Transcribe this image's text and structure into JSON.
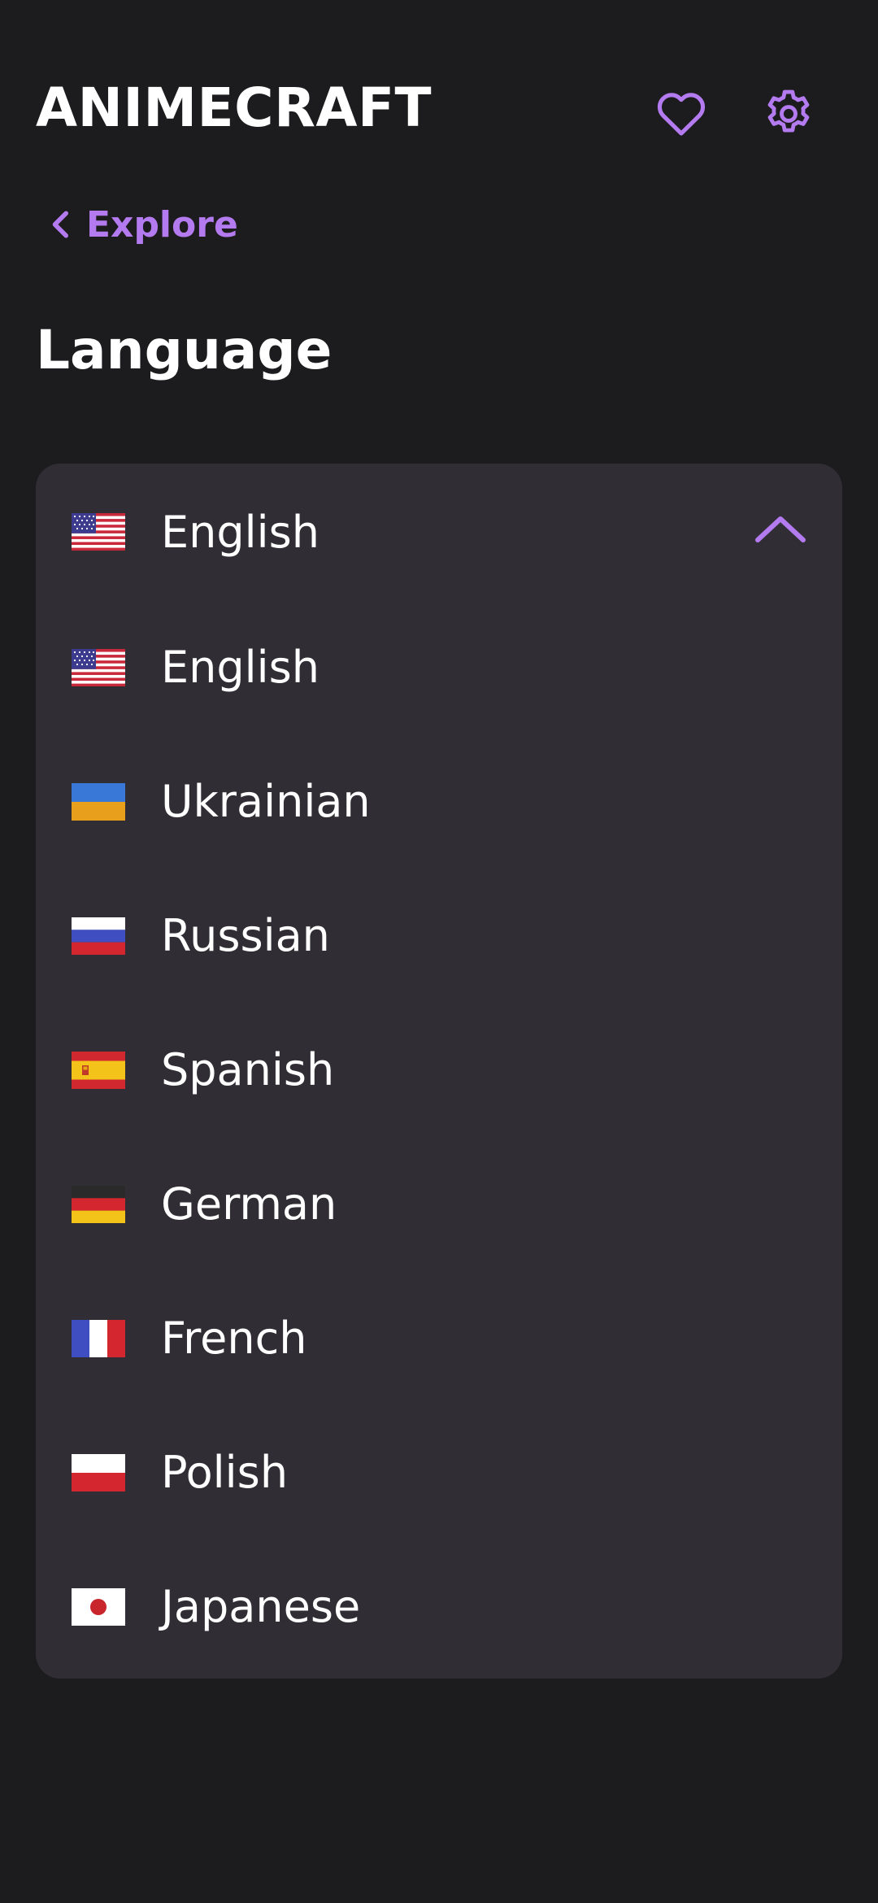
{
  "header": {
    "app_title": "ANIMECRAFT",
    "favorites_icon": "heart-icon",
    "settings_icon": "gear-icon"
  },
  "nav": {
    "back_label": "Explore",
    "back_icon": "chevron-left-icon"
  },
  "page": {
    "title": "Language"
  },
  "language_select": {
    "selected": {
      "label": "English",
      "flag": "us"
    },
    "expanded": true,
    "toggle_icon": "chevron-up-icon",
    "options": [
      {
        "label": "English",
        "flag": "us"
      },
      {
        "label": "Ukrainian",
        "flag": "ua"
      },
      {
        "label": "Russian",
        "flag": "ru"
      },
      {
        "label": "Spanish",
        "flag": "es"
      },
      {
        "label": "German",
        "flag": "de"
      },
      {
        "label": "French",
        "flag": "fr"
      },
      {
        "label": "Polish",
        "flag": "pl"
      },
      {
        "label": "Japanese",
        "flag": "jp"
      }
    ]
  },
  "colors": {
    "background": "#1c1c1e",
    "panel": "#302e34",
    "accent": "#b47bf0",
    "text": "#ffffff"
  }
}
